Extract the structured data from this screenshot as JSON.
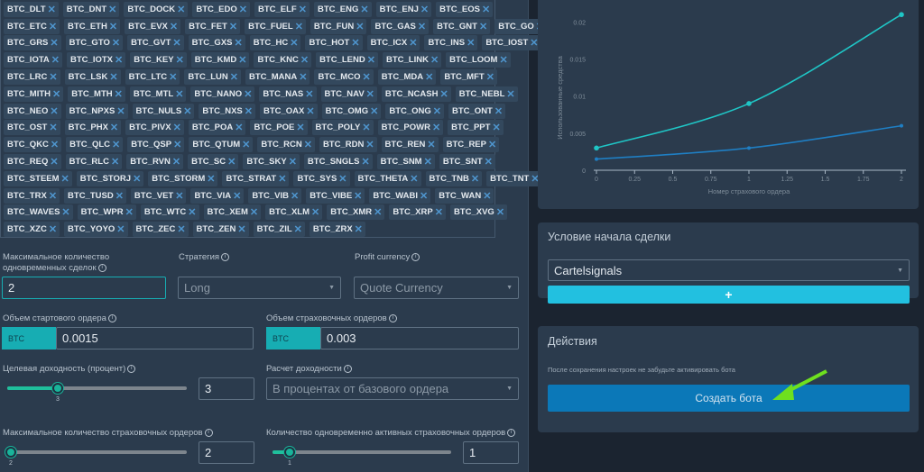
{
  "tags": {
    "remove_icon": "close-icon",
    "rows": [
      [
        "BTC_DLT",
        "BTC_DNT",
        "BTC_DOCK",
        "BTC_EDO",
        "BTC_ELF",
        "BTC_ENG",
        "BTC_ENJ",
        "BTC_EOS"
      ],
      [
        "BTC_ETC",
        "BTC_ETH",
        "BTC_EVX",
        "BTC_FET",
        "BTC_FUEL",
        "BTC_FUN",
        "BTC_GAS",
        "BTC_GNT",
        "BTC_GO"
      ],
      [
        "BTC_GRS",
        "BTC_GTO",
        "BTC_GVT",
        "BTC_GXS",
        "BTC_HC",
        "BTC_HOT",
        "BTC_ICX",
        "BTC_INS",
        "BTC_IOST"
      ],
      [
        "BTC_IOTA",
        "BTC_IOTX",
        "BTC_KEY",
        "BTC_KMD",
        "BTC_KNC",
        "BTC_LEND",
        "BTC_LINK",
        "BTC_LOOM"
      ],
      [
        "BTC_LRC",
        "BTC_LSK",
        "BTC_LTC",
        "BTC_LUN",
        "BTC_MANA",
        "BTC_MCO",
        "BTC_MDA",
        "BTC_MFT"
      ],
      [
        "BTC_MITH",
        "BTC_MTH",
        "BTC_MTL",
        "BTC_NANO",
        "BTC_NAS",
        "BTC_NAV",
        "BTC_NCASH",
        "BTC_NEBL"
      ],
      [
        "BTC_NEO",
        "BTC_NPXS",
        "BTC_NULS",
        "BTC_NXS",
        "BTC_OAX",
        "BTC_OMG",
        "BTC_ONG",
        "BTC_ONT"
      ],
      [
        "BTC_OST",
        "BTC_PHX",
        "BTC_PIVX",
        "BTC_POA",
        "BTC_POE",
        "BTC_POLY",
        "BTC_POWR",
        "BTC_PPT"
      ],
      [
        "BTC_QKC",
        "BTC_QLC",
        "BTC_QSP",
        "BTC_QTUM",
        "BTC_RCN",
        "BTC_RDN",
        "BTC_REN",
        "BTC_REP"
      ],
      [
        "BTC_REQ",
        "BTC_RLC",
        "BTC_RVN",
        "BTC_SC",
        "BTC_SKY",
        "BTC_SNGLS",
        "BTC_SNM",
        "BTC_SNT"
      ],
      [
        "BTC_STEEM",
        "BTC_STORJ",
        "BTC_STORM",
        "BTC_STRAT",
        "BTC_SYS",
        "BTC_THETA",
        "BTC_TNB",
        "BTC_TNT"
      ],
      [
        "BTC_TRX",
        "BTC_TUSD",
        "BTC_VET",
        "BTC_VIA",
        "BTC_VIB",
        "BTC_VIBE",
        "BTC_WABI",
        "BTC_WAN"
      ],
      [
        "BTC_WAVES",
        "BTC_WPR",
        "BTC_WTC",
        "BTC_XEM",
        "BTC_XLM",
        "BTC_XMR",
        "BTC_XRP",
        "BTC_XVG"
      ],
      [
        "BTC_XZC",
        "BTC_YOYO",
        "BTC_ZEC",
        "BTC_ZEN",
        "BTC_ZIL",
        "BTC_ZRX"
      ]
    ]
  },
  "form": {
    "max_deals_label_1": "Максимальное количество",
    "max_deals_label_2": "одновременных сделок",
    "max_deals_value": "2",
    "strategy_label": "Стратегия",
    "strategy_value": "Long",
    "profit_currency_label": "Profit currency",
    "profit_currency_value": "Quote Currency",
    "base_order_label": "Объем стартового ордера",
    "base_order_currency": "BTC",
    "base_order_value": "0.0015",
    "safety_order_label": "Объем страховочных ордеров",
    "safety_order_currency": "BTC",
    "safety_order_value": "0.003",
    "target_profit_label": "Целевая доходность (процент)",
    "target_profit_value": "3",
    "target_profit_slider": 3,
    "profit_calc_label": "Расчет доходности",
    "profit_calc_value": "В процентах от базового ордера",
    "max_safety_label": "Максимальное количество страховочных ордеров",
    "max_safety_value": "2",
    "max_safety_slider": 2,
    "active_safety_label": "Количество одновременно активных страховочных ордеров",
    "active_safety_value": "1",
    "active_safety_slider": 1
  },
  "chart_data": {
    "type": "line",
    "xlabel": "Номер страхового ордера",
    "ylabel": "Использованные средства",
    "xlim": [
      0,
      2
    ],
    "ylim": [
      0,
      0.022
    ],
    "xticks": [
      "0",
      "0.25",
      "0.5",
      "0.75",
      "1",
      "1.25",
      "1.5",
      "1.75",
      "2"
    ],
    "yticks": [
      "0",
      "0.005",
      "0.01",
      "0.015",
      "0.02"
    ],
    "x": [
      0,
      1,
      2
    ],
    "series": [
      {
        "color": "#1fc6c6",
        "values": [
          0.003,
          0.009,
          0.021
        ]
      },
      {
        "color": "#1f7fc4",
        "values": [
          0.0015,
          0.003,
          0.006
        ]
      }
    ]
  },
  "start_condition": {
    "title": "Условие начала сделки",
    "value": "Cartelsignals",
    "add_label": "+"
  },
  "actions": {
    "title": "Действия",
    "hint": "После сохранения настроек не забудьте активировать бота",
    "create_label": "Создать бота"
  },
  "colors": {
    "accent": "#17adb3",
    "button": "#0b78b8",
    "add_button": "#22c0e0",
    "arrow": "#6ee01f"
  }
}
